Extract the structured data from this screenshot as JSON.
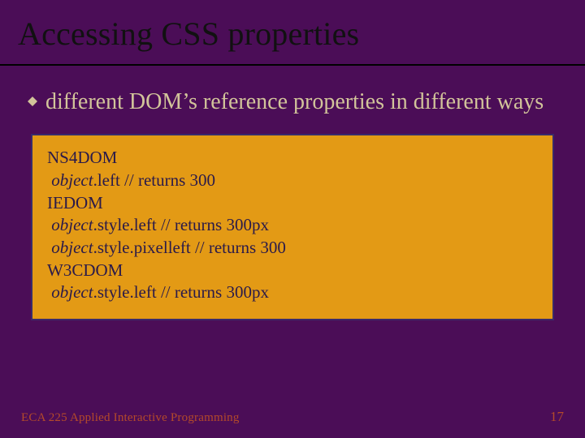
{
  "title": "Accessing CSS properties",
  "bullet": {
    "text": "different DOM’s reference properties in different ways"
  },
  "code": {
    "l1": "NS4DOM",
    "l2_ital": "object",
    "l2_rest": ".left  // returns 300",
    "l3": "IEDOM",
    "l4_ital": "object",
    "l4_rest": ".style.left  // returns 300px",
    "l5_ital": "object",
    "l5_rest": ".style.pixelleft  // returns 300",
    "l6": "W3CDOM",
    "l7_ital": "object",
    "l7_rest": ".style.left  // returns 300px"
  },
  "footer": {
    "course": "ECA 225   Applied Interactive Programming",
    "pageno": "17"
  },
  "colors": {
    "background": "#4b0d57",
    "title": "#111111",
    "bullet_text": "#d2c49a",
    "code_bg": "#e39a15",
    "code_border": "#3a2a6a",
    "code_text": "#2a1a4a",
    "footer": "#b44a2a"
  }
}
